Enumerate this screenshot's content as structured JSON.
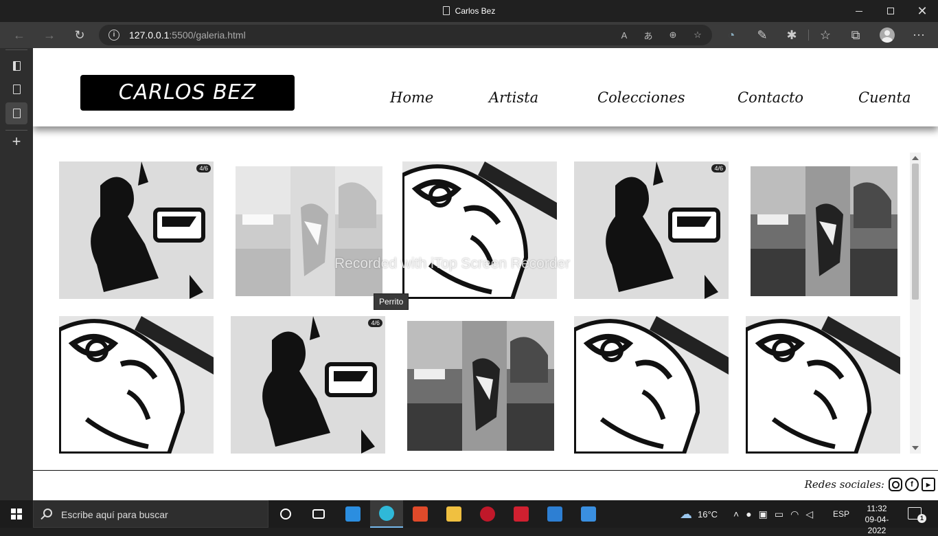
{
  "browser": {
    "window_title": "Carlos Bez",
    "url_host": "127.0.0.1",
    "url_rest": ":5500/galeria.html"
  },
  "site": {
    "logo": "CARLOS BEZ",
    "nav": [
      "Home",
      "Artista",
      "Colecciones",
      "Contacto",
      "Cuenta"
    ],
    "tooltip": "Perrito",
    "watermark": "Recorded with iTop Screen Recorder",
    "badge": "4/6",
    "footer_label": "Redes sociales:",
    "gallery": [
      {
        "art": "woman",
        "badge": true
      },
      {
        "art": "dog-photo",
        "faded": true
      },
      {
        "art": "face"
      },
      {
        "art": "woman",
        "badge": true
      },
      {
        "art": "dog-photo"
      },
      {
        "art": "face"
      },
      {
        "art": "woman",
        "badge": true
      },
      {
        "art": "dog-photo"
      },
      {
        "art": "face"
      },
      {
        "art": "face"
      }
    ]
  },
  "taskbar": {
    "search_placeholder": "Escribe aquí para buscar",
    "temperature": "16°C",
    "language": "ESP",
    "time": "11:32",
    "date": "09-04-2022",
    "notifications": "1"
  }
}
